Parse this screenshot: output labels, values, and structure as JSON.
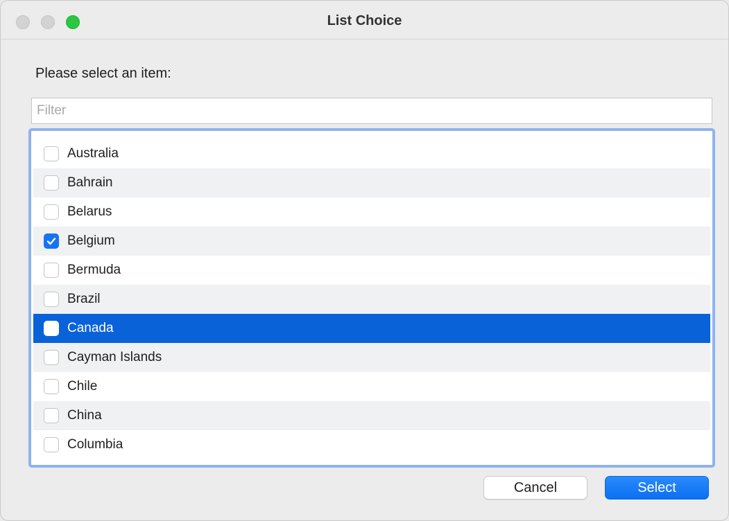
{
  "window": {
    "title": "List Choice"
  },
  "dialog": {
    "prompt": "Please select an item:",
    "filter": {
      "value": "",
      "placeholder": "Filter"
    },
    "items": [
      {
        "label": "Australia",
        "checked": false
      },
      {
        "label": "Bahrain",
        "checked": false
      },
      {
        "label": "Belarus",
        "checked": false
      },
      {
        "label": "Belgium",
        "checked": true
      },
      {
        "label": "Bermuda",
        "checked": false
      },
      {
        "label": "Brazil",
        "checked": false
      },
      {
        "label": "Canada",
        "checked": false,
        "highlighted": true
      },
      {
        "label": "Cayman Islands",
        "checked": false
      },
      {
        "label": "Chile",
        "checked": false
      },
      {
        "label": "China",
        "checked": false
      },
      {
        "label": "Columbia",
        "checked": false
      }
    ],
    "buttons": {
      "cancel_label": "Cancel",
      "select_label": "Select"
    }
  },
  "colors": {
    "accent": "#0a62d9",
    "focus_ring": "#8fb2ef",
    "zoom_button": "#2ac840",
    "checkbox_checked": "#1774f1"
  }
}
